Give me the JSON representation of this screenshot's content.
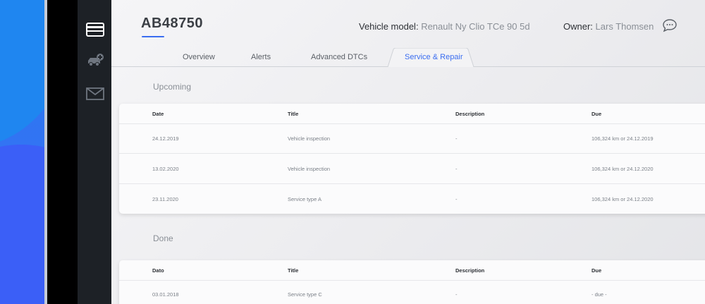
{
  "vehicle": {
    "plate": "AB48750",
    "model_label": "Vehicle model:",
    "model_value": "Renault Ny Clio TCe 90 5d",
    "owner_label": "Owner:",
    "owner_value": "Lars Thomsen"
  },
  "sidebar": {
    "icons": [
      "list-icon",
      "add-vehicle-icon",
      "mail-icon"
    ]
  },
  "tabs": [
    {
      "label": "Overview"
    },
    {
      "label": "Alerts"
    },
    {
      "label": "Advanced DTCs"
    },
    {
      "label": "Service & Repair",
      "active": true
    }
  ],
  "upcoming": {
    "title": "Upcoming",
    "columns": [
      "Date",
      "Title",
      "Description",
      "Due"
    ],
    "rows": [
      {
        "date": "24.12.2019",
        "title": "Vehicle inspection",
        "description": "-",
        "due": "106,324 km or 24.12.2019"
      },
      {
        "date": "13.02.2020",
        "title": "Vehicle inspection",
        "description": "-",
        "due": "106,324 km or 24.12.2020"
      },
      {
        "date": "23.11.2020",
        "title": "Service type A",
        "description": "-",
        "due": "106,324 km or 24.12.2020"
      }
    ]
  },
  "done": {
    "title": "Done",
    "columns": [
      "Dato",
      "Title",
      "Description",
      "Due"
    ],
    "rows": [
      {
        "date": "03.01.2018",
        "title": "Service type C",
        "description": "-",
        "due": "- due -"
      }
    ]
  },
  "colors": {
    "accent": "#3a6df0",
    "sidebar": "#1d2126"
  }
}
